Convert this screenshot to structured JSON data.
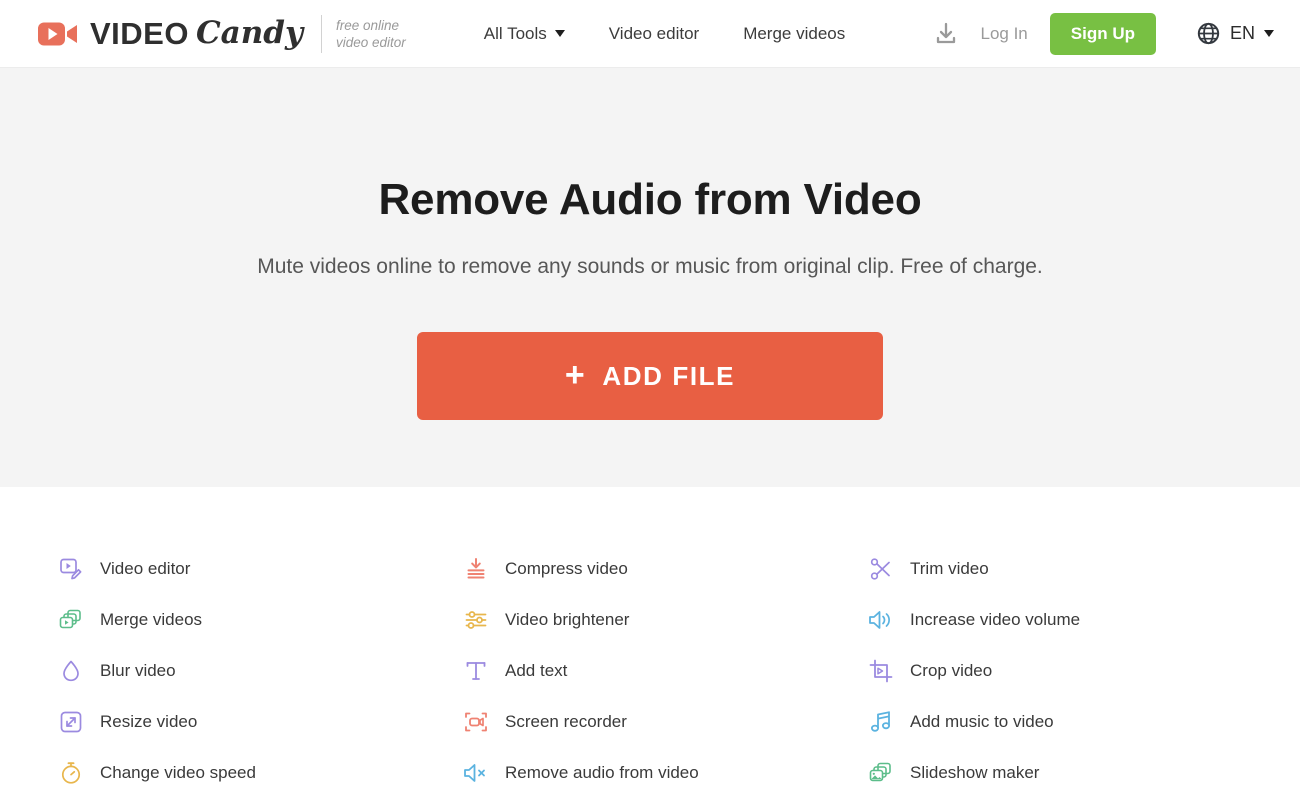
{
  "header": {
    "logo": {
      "icon": "video-camera-icon",
      "word": "VIDEO",
      "script": "Candy",
      "tagline_line1": "free online",
      "tagline_line2": "video editor"
    },
    "nav": [
      {
        "label": "All Tools",
        "has_caret": true
      },
      {
        "label": "Video editor",
        "has_caret": false
      },
      {
        "label": "Merge videos",
        "has_caret": false
      }
    ],
    "download_icon": "download-icon",
    "login_label": "Log In",
    "signup_label": "Sign Up",
    "language": {
      "icon": "globe-icon",
      "label": "EN"
    }
  },
  "hero": {
    "title": "Remove Audio from Video",
    "subtitle": "Mute videos online to remove any sounds or music from original clip. Free of charge.",
    "add_file_label": "ADD FILE",
    "add_file_plus": "+"
  },
  "tools": {
    "columns": [
      {
        "items": [
          {
            "label": "Video editor",
            "icon": "video-edit-icon",
            "color": "#9b8ae0"
          },
          {
            "label": "Merge videos",
            "icon": "merge-videos-icon",
            "color": "#5cbd8a"
          },
          {
            "label": "Blur video",
            "icon": "blur-droplet-icon",
            "color": "#9b8ae0"
          },
          {
            "label": "Resize video",
            "icon": "resize-icon",
            "color": "#9b8ae0"
          },
          {
            "label": "Change video speed",
            "icon": "speed-timer-icon",
            "color": "#e8b64c"
          }
        ]
      },
      {
        "items": [
          {
            "label": "Compress video",
            "icon": "compress-icon",
            "color": "#ef8272"
          },
          {
            "label": "Video brightener",
            "icon": "sliders-icon",
            "color": "#e8b64c"
          },
          {
            "label": "Add text",
            "icon": "add-text-icon",
            "color": "#9b8ae0"
          },
          {
            "label": "Screen recorder",
            "icon": "screen-recorder-icon",
            "color": "#ef8272"
          },
          {
            "label": "Remove audio from video",
            "icon": "mute-speaker-icon",
            "color": "#5bb3e0"
          }
        ]
      },
      {
        "items": [
          {
            "label": "Trim video",
            "icon": "scissors-icon",
            "color": "#9b8ae0"
          },
          {
            "label": "Increase video volume",
            "icon": "volume-up-icon",
            "color": "#5bb3e0"
          },
          {
            "label": "Crop video",
            "icon": "crop-icon",
            "color": "#9b8ae0"
          },
          {
            "label": "Add music to video",
            "icon": "music-note-icon",
            "color": "#5bb3e0"
          },
          {
            "label": "Slideshow maker",
            "icon": "slideshow-icon",
            "color": "#5cbd8a"
          }
        ]
      }
    ]
  },
  "colors": {
    "brand_coral": "#e85f43",
    "brand_green": "#78c043",
    "hero_bg": "#f4f4f4",
    "text_dark": "#1d1d1d"
  }
}
